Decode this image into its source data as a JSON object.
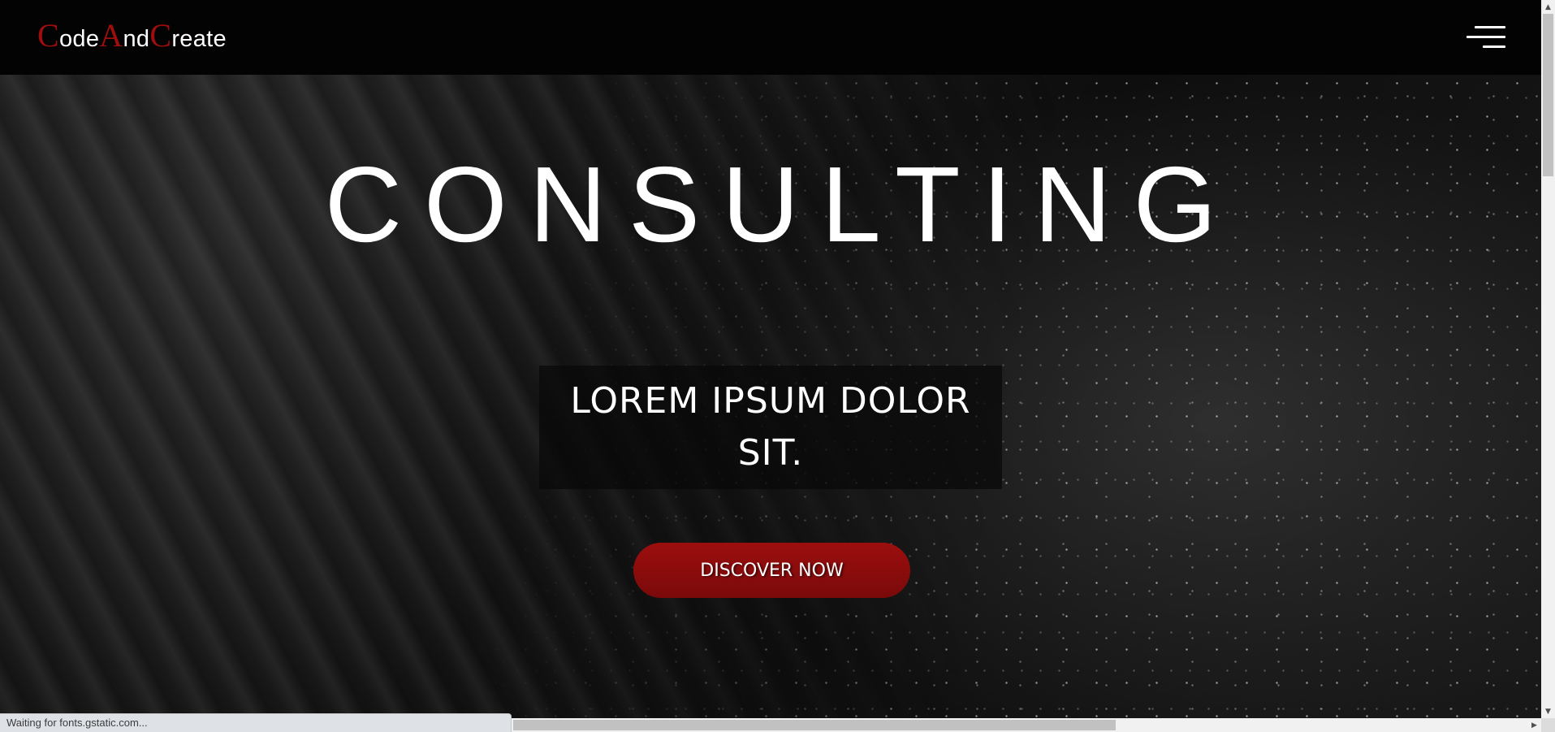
{
  "navbar": {
    "logo": {
      "parts": [
        {
          "text": "C",
          "accent": true
        },
        {
          "text": "ode",
          "accent": false
        },
        {
          "text": "A",
          "accent": true
        },
        {
          "text": "nd",
          "accent": false
        },
        {
          "text": "C",
          "accent": true
        },
        {
          "text": "reate",
          "accent": false
        }
      ]
    },
    "menu_icon": "hamburger-menu-icon"
  },
  "hero": {
    "title": "CONSULTING",
    "tagline": "LOREM IPSUM DOLOR SIT.",
    "cta_label": "DISCOVER NOW"
  },
  "browser": {
    "status_text": "Waiting for fonts.gstatic.com..."
  },
  "colors": {
    "accent": "#a00d0d",
    "button": "#8e0c0c",
    "navbar": "#030303",
    "text": "#ffffff"
  }
}
